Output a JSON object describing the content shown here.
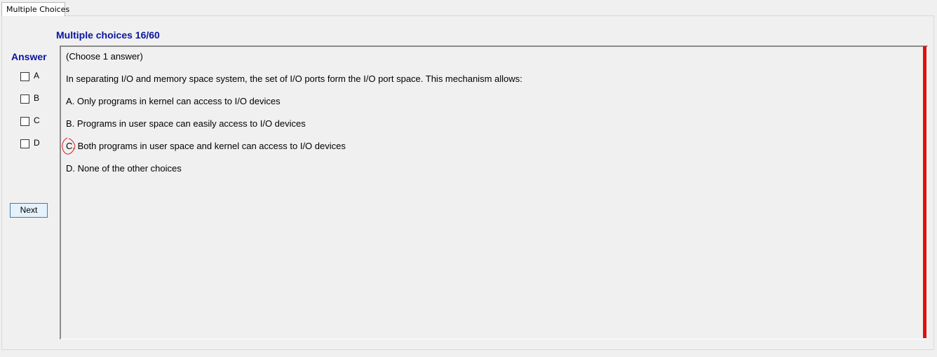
{
  "tab": {
    "label": "Multiple Choices"
  },
  "header": {
    "title": "Multiple choices 16/60"
  },
  "answer_panel": {
    "label": "Answer",
    "options": [
      {
        "letter": "A",
        "checked": false
      },
      {
        "letter": "B",
        "checked": false
      },
      {
        "letter": "C",
        "checked": false
      },
      {
        "letter": "D",
        "checked": false
      }
    ],
    "next_label": "Next"
  },
  "question": {
    "instruction": "(Choose 1 answer)",
    "stem": "In separating I/O and memory space system, the set of I/O ports form the I/O port space. This mechanism  allows:",
    "choices": [
      {
        "text": "A.  Only  programs in kernel can access to I/O devices"
      },
      {
        "text": "B.  Programs in user space can easily access to I/O devices"
      },
      {
        "text": "C.  Both programs in user space and kernel can access to I/O devices"
      },
      {
        "text": "D.  None of the other choices"
      }
    ]
  },
  "colors": {
    "title_blue": "#0a14a0",
    "scroll_bar_red": "#e01010",
    "annotation_red": "#e02020"
  }
}
